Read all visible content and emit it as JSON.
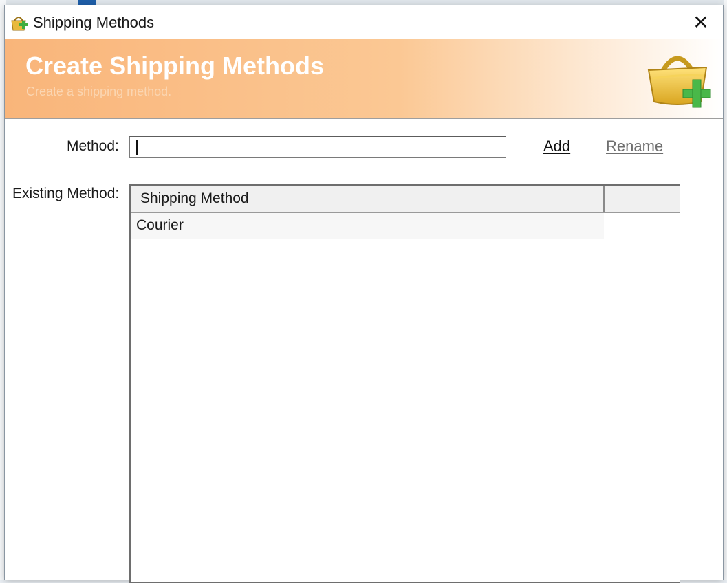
{
  "window": {
    "title": "Shipping Methods",
    "close_glyph": "✕"
  },
  "banner": {
    "title": "Create Shipping Methods",
    "subtitle": "Create a shipping method."
  },
  "form": {
    "method_label": "Method:",
    "method_value": "",
    "add_label": "Add",
    "rename_label": "Rename",
    "existing_label": "Existing Method:"
  },
  "grid": {
    "columns": [
      "Shipping Method"
    ],
    "rows": [
      {
        "method": "Courier"
      }
    ]
  },
  "colors": {
    "banner_start": "#f9b57a",
    "banner_title": "#ffffff",
    "link_disabled": "#6f6f6f"
  },
  "icons": {
    "window_icon": "basket-add-icon",
    "banner_icon": "basket-add-icon"
  }
}
